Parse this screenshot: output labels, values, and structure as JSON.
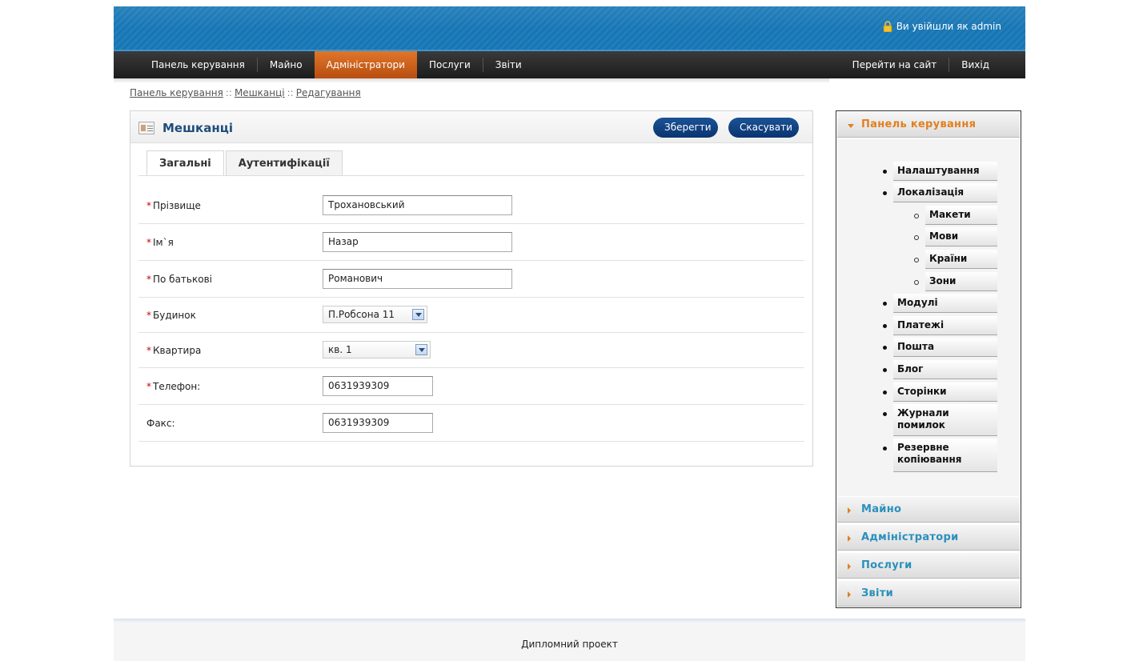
{
  "header": {
    "login_text": "Ви увійшли як admin"
  },
  "nav": {
    "left": [
      "Панель керування",
      "Майно",
      "Адміністратори",
      "Послуги",
      "Звіти"
    ],
    "active": "Адміністратори",
    "right": [
      "Перейти на сайт",
      "Вихід"
    ]
  },
  "breadcrumb": {
    "items": [
      "Панель керування",
      "Мешканці",
      "Редагування"
    ],
    "separator": "::"
  },
  "panel": {
    "title": "Мешканці",
    "save_label": "Зберегти",
    "cancel_label": "Скасувати"
  },
  "tabs": [
    "Загальні",
    "Аутентифікації"
  ],
  "form": {
    "required_mark": "*",
    "fields": [
      {
        "label": "Прізвище",
        "value": "Трохановський"
      },
      {
        "label": "Ім`я",
        "value": "Назар"
      },
      {
        "label": "По батькові",
        "value": "Романович"
      },
      {
        "label": "Будинок",
        "value": "П.Робсона 11"
      },
      {
        "label": "Квартира",
        "value": "кв. 1"
      },
      {
        "label": "Телефон:",
        "value": "0631939309"
      },
      {
        "label": "Факс:",
        "value": "0631939309"
      }
    ]
  },
  "sidebar": {
    "sections": [
      "Панель керування",
      "Майно",
      "Адміністратори",
      "Послуги",
      "Звіти"
    ],
    "items": [
      {
        "label": "Налаштування"
      },
      {
        "label": "Локалізація"
      },
      {
        "label": "Макети"
      },
      {
        "label": "Мови"
      },
      {
        "label": "Країни"
      },
      {
        "label": "Зони"
      },
      {
        "label": "Модулі"
      },
      {
        "label": "Платежі"
      },
      {
        "label": "Пошта"
      },
      {
        "label": "Блог"
      },
      {
        "label": "Сторінки"
      },
      {
        "label": "Журнали помилок"
      },
      {
        "label": "Резервне копіювання"
      }
    ]
  },
  "footer": {
    "text": "Дипломний проект"
  },
  "colors": {
    "header_blue": "#1f7fbd",
    "nav_active": "#d0651f",
    "button_blue": "#0e3c7a",
    "title_blue": "#1d4d7a",
    "sidebar_link": "#2a8fbc",
    "sidebar_open": "#e07f20",
    "required": "#cc0000"
  },
  "icons": [
    "lock-icon",
    "residents-card-icon",
    "select-arrow-icon",
    "accordion-arrow-icon"
  ]
}
